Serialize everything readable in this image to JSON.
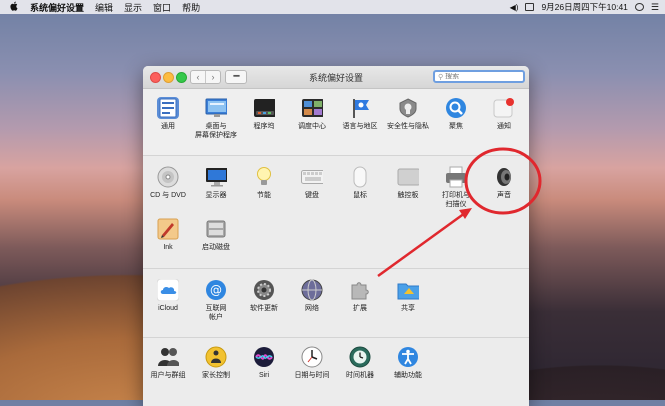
{
  "menubar": {
    "apple": "",
    "app_name": "系统偏好设置",
    "items": [
      "编辑",
      "显示",
      "窗口",
      "帮助"
    ],
    "datetime": "9月26日周四下午10:41"
  },
  "window": {
    "title": "系统偏好设置",
    "search_placeholder": "搜索",
    "nav_back": "‹",
    "nav_forward": "›"
  },
  "sections": {
    "personal": [
      {
        "label": "通用",
        "icon": "general-icon"
      },
      {
        "label": "桌面与\n屏幕保护程序",
        "icon": "desktop-icon"
      },
      {
        "label": "程序坞",
        "icon": "dock-icon"
      },
      {
        "label": "调度中心",
        "icon": "mission-control-icon"
      },
      {
        "label": "语言与地区",
        "icon": "language-icon"
      },
      {
        "label": "安全性与隐私",
        "icon": "security-icon"
      },
      {
        "label": "聚焦",
        "icon": "spotlight-icon"
      },
      {
        "label": "通知",
        "icon": "notifications-icon"
      }
    ],
    "hardware": [
      {
        "label": "CD 与 DVD",
        "icon": "cd-dvd-icon"
      },
      {
        "label": "显示器",
        "icon": "display-icon"
      },
      {
        "label": "节能",
        "icon": "energy-icon"
      },
      {
        "label": "键盘",
        "icon": "keyboard-icon"
      },
      {
        "label": "鼠标",
        "icon": "mouse-icon"
      },
      {
        "label": "触控板",
        "icon": "trackpad-icon"
      },
      {
        "label": "打印机与\n扫描仪",
        "icon": "printer-icon"
      },
      {
        "label": "声音",
        "icon": "sound-icon"
      },
      {
        "label": "Ink",
        "icon": "ink-icon"
      },
      {
        "label": "启动磁盘",
        "icon": "startup-disk-icon"
      }
    ],
    "internet": [
      {
        "label": "iCloud",
        "icon": "icloud-icon"
      },
      {
        "label": "互联网\n帐户",
        "icon": "internet-accounts-icon"
      },
      {
        "label": "软件更新",
        "icon": "software-update-icon"
      },
      {
        "label": "网络",
        "icon": "network-icon"
      },
      {
        "label": "扩展",
        "icon": "extensions-icon"
      },
      {
        "label": "共享",
        "icon": "sharing-icon"
      }
    ],
    "system": [
      {
        "label": "用户与群组",
        "icon": "users-groups-icon"
      },
      {
        "label": "家长控制",
        "icon": "parental-controls-icon"
      },
      {
        "label": "Siri",
        "icon": "siri-icon"
      },
      {
        "label": "日期与时间",
        "icon": "date-time-icon"
      },
      {
        "label": "时间机器",
        "icon": "time-machine-icon"
      },
      {
        "label": "辅助功能",
        "icon": "accessibility-icon"
      }
    ]
  },
  "annotation_color": "#e0282e"
}
